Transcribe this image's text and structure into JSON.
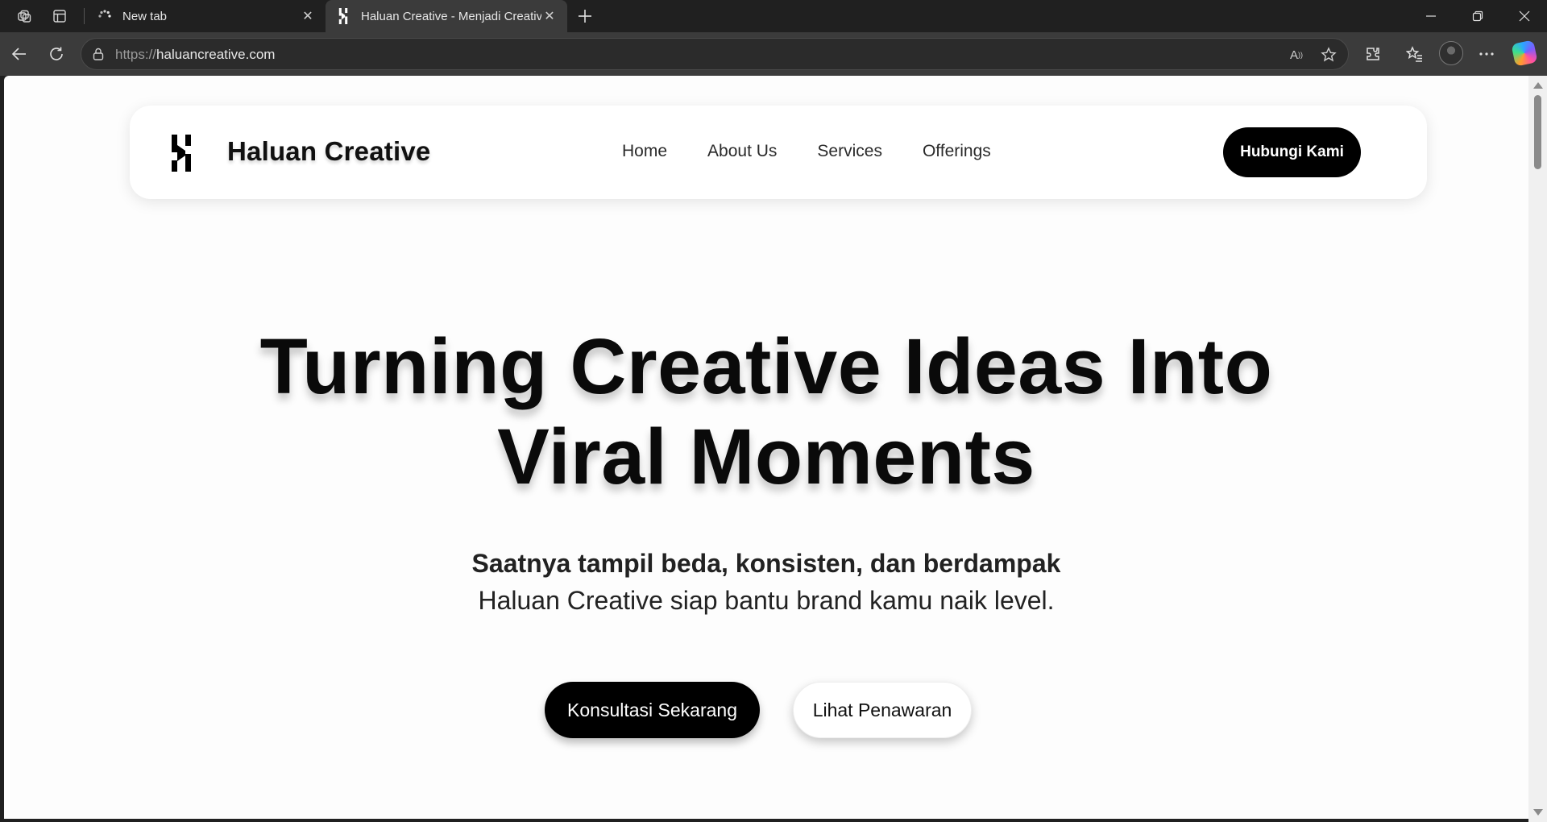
{
  "browser": {
    "tabs": [
      {
        "title": "New tab",
        "favicon": "loading-spinner-icon"
      },
      {
        "title": "Haluan Creative - Menjadi Creativ",
        "favicon": "haluan-logo-icon",
        "active": true
      }
    ],
    "url_protocol": "https://",
    "url_host": "haluancreative.com"
  },
  "site": {
    "brand": "Haluan Creative",
    "nav": [
      "Home",
      "About Us",
      "Services",
      "Offerings"
    ],
    "cta_top": "Hubungi Kami",
    "hero": {
      "title_line1": "Turning Creative Ideas Into",
      "title_line2": "Viral Moments",
      "subtitle_bold": "Saatnya tampil beda, konsisten, dan berdampak",
      "subtitle": "Haluan Creative siap bantu brand kamu naik level.",
      "primary_button": "Konsultasi Sekarang",
      "secondary_button": "Lihat Penawaran"
    }
  },
  "colors": {
    "chrome_dark": "#202020",
    "toolbar": "#3b3b3b",
    "page_bg": "#fdfdfd",
    "accent": "#000000"
  }
}
